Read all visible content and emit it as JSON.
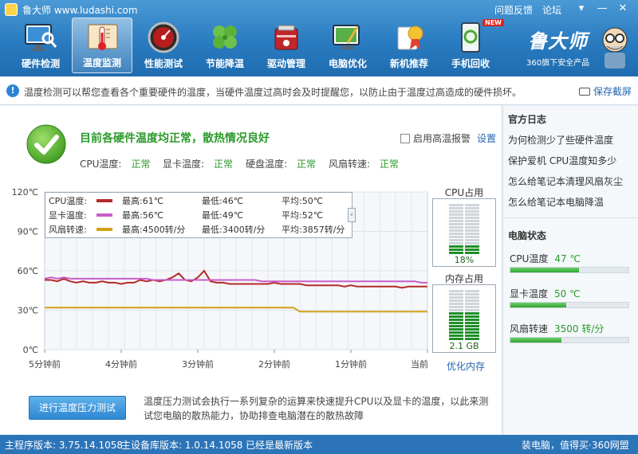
{
  "app": {
    "title": "鲁大师 www.ludashi.com",
    "links": [
      "问题反馈",
      "论坛"
    ],
    "brand_name": "鲁大师",
    "brand_sub": "360旗下安全产品",
    "new_badge": "NEW"
  },
  "nav": [
    {
      "label": "硬件检测",
      "icon": "monitor-magnifier-icon"
    },
    {
      "label": "温度监测",
      "icon": "thermometer-icon",
      "active": true
    },
    {
      "label": "性能测试",
      "icon": "speedometer-icon"
    },
    {
      "label": "节能降温",
      "icon": "clover-icon"
    },
    {
      "label": "驱动管理",
      "icon": "toolbox-icon"
    },
    {
      "label": "电脑优化",
      "icon": "broom-screen-icon"
    },
    {
      "label": "新机推荐",
      "icon": "award-medal-icon"
    },
    {
      "label": "手机回收",
      "icon": "phone-recycle-icon"
    }
  ],
  "info": {
    "text": "温度检测可以帮您查看各个重要硬件的温度，当硬件温度过高时会及时提醒您，以防止由于温度过高造成的硬件损坏。",
    "screenshot": "保存截屏"
  },
  "status": {
    "title": "目前各硬件温度均正常，散热情况良好",
    "alarm_label": "启用高温报警",
    "settings": "设置",
    "items": [
      {
        "label": "CPU温度:",
        "value": "正常"
      },
      {
        "label": "显卡温度:",
        "value": "正常"
      },
      {
        "label": "硬盘温度:",
        "value": "正常"
      },
      {
        "label": "风扇转速:",
        "value": "正常"
      }
    ]
  },
  "legend": [
    {
      "name": "CPU温度:",
      "color": "#b52a2a",
      "max": "最高:61℃",
      "min": "最低:46℃",
      "avg": "平均:50℃"
    },
    {
      "name": "显卡温度:",
      "color": "#c85ec8",
      "max": "最高:56℃",
      "min": "最低:49℃",
      "avg": "平均:52℃"
    },
    {
      "name": "风扇转速:",
      "color": "#d4a017",
      "max": "最高:4500转/分",
      "min": "最低:3400转/分",
      "avg": "平均:3857转/分"
    }
  ],
  "chart_data": {
    "type": "line",
    "y_ticks": [
      "120℃",
      "90℃",
      "60℃",
      "30℃",
      "0℃"
    ],
    "x_ticks": [
      "5分钟前",
      "4分钟前",
      "3分钟前",
      "2分钟前",
      "1分钟前",
      "当前"
    ],
    "ylim": [
      0,
      120
    ],
    "grid": true,
    "series": [
      {
        "name": "CPU温度",
        "color": "#b52a2a",
        "values": [
          53,
          53,
          52,
          54,
          52,
          51,
          52,
          51,
          51,
          52,
          51,
          51,
          50,
          51,
          51,
          53,
          52,
          53,
          52,
          53,
          55,
          58,
          53,
          52,
          55,
          60,
          52,
          51,
          51,
          50,
          50,
          50,
          50,
          50,
          50,
          50,
          51,
          50,
          50,
          50,
          50,
          49,
          49,
          49,
          49,
          49,
          49,
          48,
          49,
          48,
          48,
          48,
          48,
          48,
          48,
          48,
          47,
          48,
          48,
          48,
          48
        ]
      },
      {
        "name": "显卡温度",
        "color": "#c85ec8",
        "values": [
          54,
          55,
          54,
          55,
          54,
          54,
          54,
          54,
          54,
          54,
          54,
          54,
          54,
          54,
          54,
          54,
          54,
          53,
          53,
          53,
          53,
          53,
          53,
          53,
          53,
          53,
          53,
          53,
          53,
          53,
          53,
          53,
          53,
          53,
          52,
          52,
          52,
          52,
          52,
          52,
          52,
          52,
          52,
          52,
          52,
          52,
          52,
          52,
          52,
          52,
          52,
          52,
          52,
          52,
          52,
          52,
          52,
          52,
          52,
          51,
          51
        ]
      },
      {
        "name": "风扇转速",
        "color": "#d4a017",
        "values": [
          32,
          32,
          32,
          32,
          32,
          32,
          32,
          32,
          32,
          32,
          32,
          32,
          32,
          32,
          32,
          32,
          32,
          32,
          32,
          32,
          32,
          32,
          32,
          32,
          32,
          32,
          32,
          32,
          32,
          32,
          32,
          32,
          32,
          32,
          32,
          32,
          32,
          32,
          32,
          32,
          29,
          29,
          29,
          29,
          29,
          29,
          29,
          29,
          29,
          29,
          29,
          29,
          29,
          29,
          29,
          29,
          29,
          29,
          29,
          29,
          29
        ]
      }
    ]
  },
  "gauges": {
    "cpu": {
      "title": "CPU占用",
      "value": "18%",
      "fraction": 0.18
    },
    "mem": {
      "title": "内存占用",
      "value": "2.1 GB",
      "fraction": 0.55
    },
    "optimize": "优化内存"
  },
  "stress": {
    "button": "进行温度压力测试",
    "desc": "温度压力测试会执行一系列复杂的运算来快速提升CPU以及显卡的温度，以此来测试您电脑的散热能力，协助排查电脑潜在的散热故障"
  },
  "side": {
    "log_title": "官方日志",
    "logs": [
      "为何检测少了些硬件温度",
      "保护爱机 CPU温度知多少",
      "怎么给笔记本清理风扇灰尘",
      "怎么给笔记本电脑降温"
    ],
    "pc_title": "电脑状态",
    "pc": [
      {
        "label": "CPU温度",
        "value": "47 ℃",
        "fraction": 0.58
      },
      {
        "label": "显卡温度",
        "value": "50 ℃",
        "fraction": 0.47
      },
      {
        "label": "风扇转速",
        "value": "3500 转/分",
        "fraction": 0.43
      }
    ]
  },
  "statusbar": {
    "main_ver": "主程序版本: 3.75.14.1058",
    "db_ver": "主设备库版本: 1.0.14.1058",
    "latest": "已经是最新版本",
    "right": "装电脑，值得买·360网盟"
  }
}
